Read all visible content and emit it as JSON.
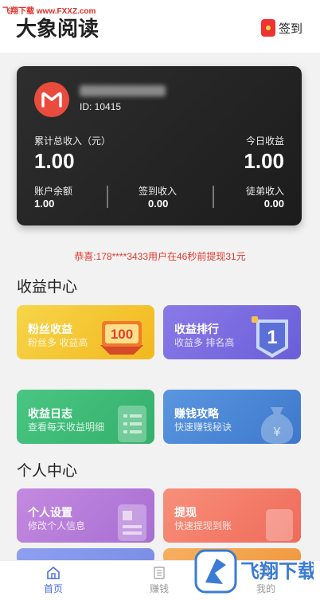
{
  "watermark": "飞翔下载 www.FXXZ.com",
  "header": {
    "title": "大象阅读",
    "checkin_label": "签到"
  },
  "account": {
    "id_text": "ID: 10415",
    "total_label": "累计总收入（元）",
    "total_value": "1.00",
    "today_label": "今日收益",
    "today_value": "1.00",
    "stats": [
      {
        "label": "账户余额",
        "value": "1.00"
      },
      {
        "label": "签到收入",
        "value": "0.00"
      },
      {
        "label": "徒弟收入",
        "value": "0.00"
      }
    ]
  },
  "notice": "恭喜:178****3433用户在46秒前提现31元",
  "income_center": {
    "title": "收益中心",
    "tiles": [
      {
        "title": "粉丝收益",
        "subtitle": "粉丝多 收益高",
        "badge": "100",
        "color": "#f2c12e"
      },
      {
        "title": "收益排行",
        "subtitle": "收益多 排名高",
        "badge": "1",
        "color": "#7b6ee0"
      },
      {
        "title": "收益日志",
        "subtitle": "查看每天收益明细",
        "color": "#3dbb76"
      },
      {
        "title": "赚钱攻略",
        "subtitle": "快速赚钱秘诀",
        "color": "#4a86d8"
      }
    ]
  },
  "personal_center": {
    "title": "个人中心",
    "tiles": [
      {
        "title": "个人设置",
        "subtitle": "修改个人信息",
        "color": "#b97ad8"
      },
      {
        "title": "提现",
        "subtitle": "快速提现到账",
        "color": "#f2796a"
      }
    ]
  },
  "tabbar": {
    "tabs": [
      {
        "label": "首页"
      },
      {
        "label": "赚钱"
      },
      {
        "label": "我的"
      }
    ]
  },
  "brand_overlay": {
    "text": "飞翔下载"
  }
}
